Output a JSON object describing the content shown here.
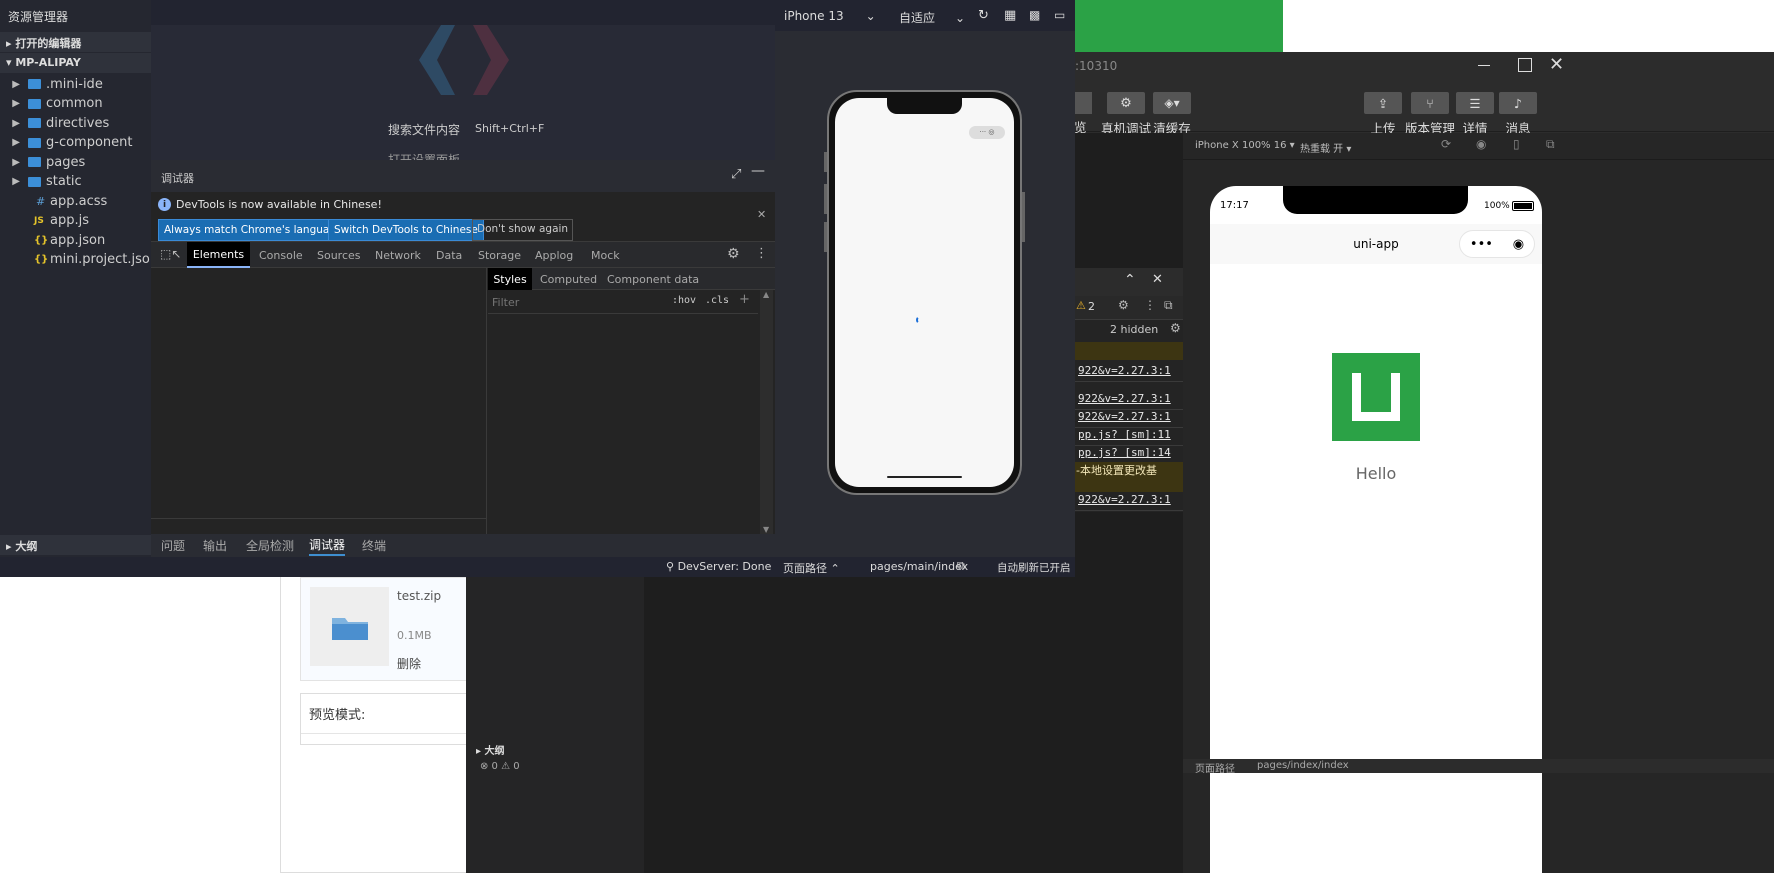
{
  "explorer": {
    "title": "资源管理器",
    "open_editors": "打开的编辑器",
    "project": "MP-ALIPAY",
    "folders": [
      ".mini-ide",
      "common",
      "directives",
      "g-component",
      "pages",
      "static"
    ],
    "files": [
      {
        "icon": "#",
        "name": "app.acss"
      },
      {
        "icon": "JS",
        "name": "app.js"
      },
      {
        "icon": "{}",
        "name": "app.json"
      },
      {
        "icon": "{}",
        "name": "mini.project.json"
      }
    ],
    "outline": "大纲"
  },
  "welcome": {
    "search_label": "搜索文件内容",
    "search_shortcut": "Shift+Ctrl+F",
    "partial": "打开设置面板"
  },
  "devtools": {
    "title": "调试器",
    "notice": "DevTools is now available in Chinese!",
    "btn_match": "Always match Chrome's language",
    "btn_switch": "Switch DevTools to Chinese",
    "btn_dismiss": "Don't show again",
    "tabs": [
      "Elements",
      "Console",
      "Sources",
      "Network",
      "Data",
      "Storage",
      "Applog",
      "Mock"
    ],
    "side_tabs": [
      "Styles",
      "Computed",
      "Component data"
    ],
    "filter_placeholder": "Filter",
    "hov": ":hov",
    "cls": ".cls"
  },
  "bottom_panel": {
    "tabs": [
      "问题",
      "输出",
      "全局检测",
      "调试器",
      "终端"
    ],
    "active": "调试器"
  },
  "statusbar": {
    "devserver": "DevServer: Done",
    "path_label": "页面路径",
    "path": "pages/main/index",
    "auto_refresh": "自动刷新已开启"
  },
  "simulator": {
    "device": "iPhone 13",
    "scale": "自适应"
  },
  "wechat": {
    "title_partial": ":10310",
    "tb_partial": "览",
    "tb_items": [
      "真机调试",
      "清缓存"
    ],
    "tb_right": [
      "上传",
      "版本管理",
      "详情",
      "消息"
    ],
    "device_select": "iPhone X 100% 16",
    "hot_reload": "热重载 开",
    "phone_time": "17:17",
    "phone_battery": "100%",
    "nav_title": "uni-app",
    "hello": "Hello",
    "warn_count": "2",
    "hidden": "2 hidden",
    "console_lines": [
      "922&v=2.27.3:1",
      "922&v=2.27.3:1",
      "922&v=2.27.3:1",
      "pp.js? [sm]:11",
      "pp.js? [sm]:14",
      "922&v=2.27.3:1"
    ],
    "warn_text": "-本地设置更改基",
    "path_label": "页面路径",
    "path": "pages/index/index",
    "outline": "大纲",
    "status_counts": "⊗ 0 ⚠ 0"
  },
  "upload": {
    "file_name": "test.zip",
    "file_size": "0.1MB",
    "delete": "删除",
    "preview_mode": "预览模式:"
  },
  "colors": {
    "accent": "#1a6db3",
    "green": "#2ba246"
  }
}
